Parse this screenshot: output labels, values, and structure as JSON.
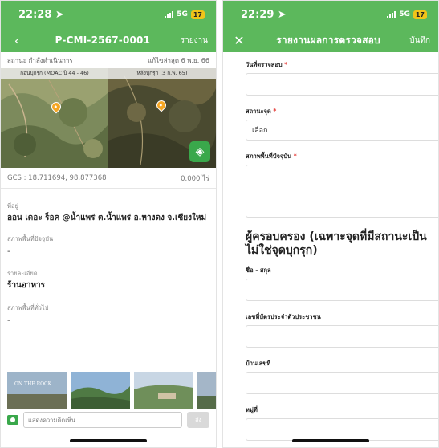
{
  "left": {
    "status_time": "22:28",
    "network": "5G",
    "battery": "17",
    "nav_title": "P-CMI-2567-0001",
    "nav_action": "รายงาน",
    "status_label": "สถานะ กำลังดำเนินการ",
    "updated": "แก้ไขล่าสุด 6 พ.ย. 66",
    "map_before_label": "ก่อนบุกรุก (MOAC ปี 44 - 46)",
    "map_after_label": "หลังบุกรุก (3 ก.พ. 65)",
    "gcs": "GCS : 18.711694, 98.877368",
    "area": "0.000 ไร่",
    "address_label": "ที่อยู่",
    "address_value": "ออน เดอะ ร็อค @น้ำแพร่ ต.น้ำแพร่ อ.หางดง จ.เชียงใหม่",
    "current_label": "สภาพพื้นที่ปัจจุบัน",
    "current_value": "-",
    "detail_label": "รายละเอียด",
    "detail_value": "ร้านอาหาร",
    "general_label": "สภาพพื้นที่ทั่วไป",
    "general_value": "-",
    "photo_caption": "ON THE ROCK",
    "comment_placeholder": "แสดงความคิดเห็น",
    "send_label": "ส่ง"
  },
  "right": {
    "status_time": "22:29",
    "network": "5G",
    "battery": "17",
    "nav_title": "รายงานผลการตรวจสอบ",
    "nav_action": "บันทึก",
    "date_label": "วันที่ตรวจสอบ",
    "status_field_label": "สถานะจุด",
    "select_value": "เลือก",
    "current_field_label": "สภาพพื้นที่ปัจจุบัน",
    "owner_title": "ผู้ครอบครอง (เฉพาะจุดที่มีสถานะเป็น ไม่ใช่จุดบุกรุก)",
    "name_label": "ชื่อ - สกุล",
    "id_label": "เลขที่บัตรประจำตัวประชาชน",
    "house_label": "บ้านเลขที่",
    "village_label": "หมู่ที่",
    "required_mark": "*"
  },
  "colors": {
    "accent": "#5cb85c",
    "required": "#e53935",
    "pin": "#f5a623"
  },
  "icons": {
    "back": "chevron-left-icon",
    "close": "close-icon",
    "location": "location-arrow-icon",
    "layers": "map-layers-icon",
    "camera": "camera-icon",
    "dropdown": "chevron-down-icon"
  }
}
